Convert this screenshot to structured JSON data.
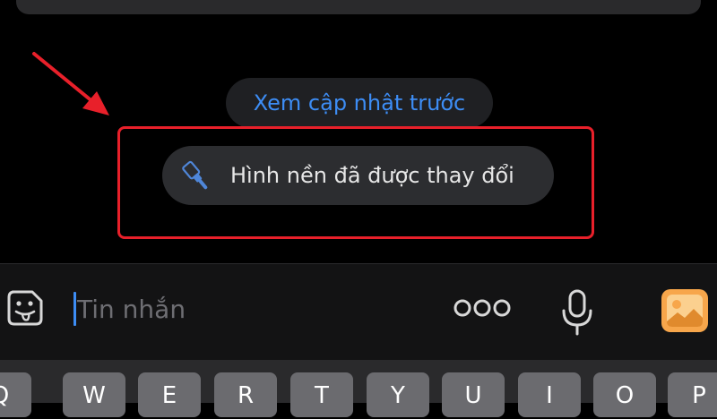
{
  "chat": {
    "prev_updates_label": "Xem cập nhật trước",
    "system_message": "Hình nền đã được thay đổi"
  },
  "composer": {
    "placeholder": "Tin nhắn"
  },
  "keyboard": {
    "keys": [
      "Q",
      "W",
      "E",
      "R",
      "T",
      "Y",
      "U",
      "I",
      "O",
      "P"
    ]
  },
  "icons": {
    "sticker": "sticker-face-icon",
    "brush": "paint-brush-icon",
    "more": "more-dots-icon",
    "mic": "microphone-icon",
    "image": "image-gallery-icon"
  },
  "colors": {
    "background": "#000000",
    "link_blue": "#3d8df5",
    "highlight_red": "#e8202a",
    "image_button_orange": "#f7a64b"
  }
}
